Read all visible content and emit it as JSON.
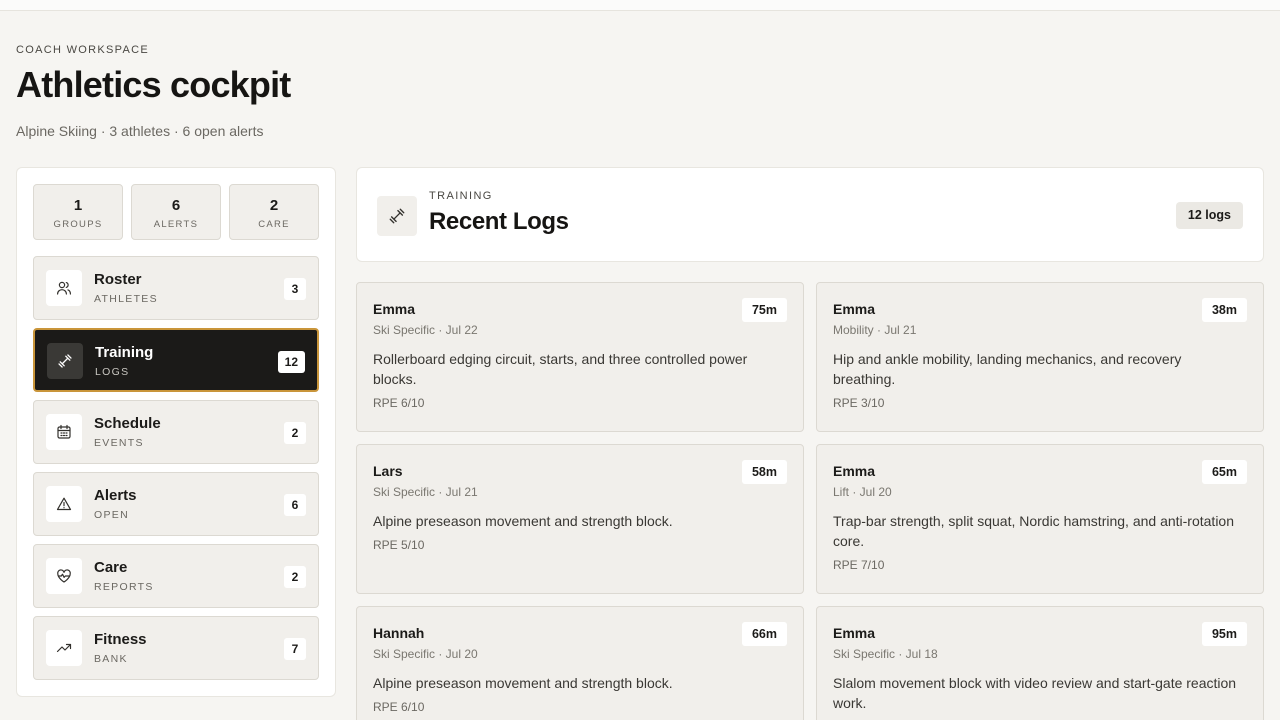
{
  "header": {
    "eyebrow": "COACH WORKSPACE",
    "title": "Athletics cockpit",
    "subtitle": "Alpine Skiing · 3 athletes · 6 open alerts"
  },
  "stats": [
    {
      "value": "1",
      "label": "GROUPS"
    },
    {
      "value": "6",
      "label": "ALERTS"
    },
    {
      "value": "2",
      "label": "CARE"
    }
  ],
  "nav": [
    {
      "icon": "users-icon",
      "name": "Roster",
      "sub": "ATHLETES",
      "count": "3"
    },
    {
      "icon": "dumbbell-icon",
      "name": "Training",
      "sub": "LOGS",
      "count": "12"
    },
    {
      "icon": "calendar-icon",
      "name": "Schedule",
      "sub": "EVENTS",
      "count": "2"
    },
    {
      "icon": "alert-triangle-icon",
      "name": "Alerts",
      "sub": "OPEN",
      "count": "6"
    },
    {
      "icon": "heart-pulse-icon",
      "name": "Care",
      "sub": "REPORTS",
      "count": "2"
    },
    {
      "icon": "trending-up-icon",
      "name": "Fitness",
      "sub": "BANK",
      "count": "7"
    }
  ],
  "main": {
    "kicker": "TRAINING",
    "title": "Recent Logs",
    "count_label": "12 logs",
    "icon": "dumbbell-icon"
  },
  "logs": [
    {
      "athlete": "Emma",
      "meta": "Ski Specific · Jul 22",
      "description": "Rollerboard edging circuit, starts, and three controlled power blocks.",
      "rpe": "RPE 6/10",
      "duration": "75m"
    },
    {
      "athlete": "Emma",
      "meta": "Mobility · Jul 21",
      "description": "Hip and ankle mobility, landing mechanics, and recovery breathing.",
      "rpe": "RPE 3/10",
      "duration": "38m"
    },
    {
      "athlete": "Lars",
      "meta": "Ski Specific · Jul 21",
      "description": "Alpine preseason movement and strength block.",
      "rpe": "RPE 5/10",
      "duration": "58m"
    },
    {
      "athlete": "Emma",
      "meta": "Lift · Jul 20",
      "description": "Trap-bar strength, split squat, Nordic hamstring, and anti-rotation core.",
      "rpe": "RPE 7/10",
      "duration": "65m"
    },
    {
      "athlete": "Hannah",
      "meta": "Ski Specific · Jul 20",
      "description": "Alpine preseason movement and strength block.",
      "rpe": "RPE 6/10",
      "duration": "66m"
    },
    {
      "athlete": "Emma",
      "meta": "Ski Specific · Jul 18",
      "description": "Slalom movement block with video review and start-gate reaction work.",
      "rpe": "",
      "duration": "95m"
    }
  ]
}
